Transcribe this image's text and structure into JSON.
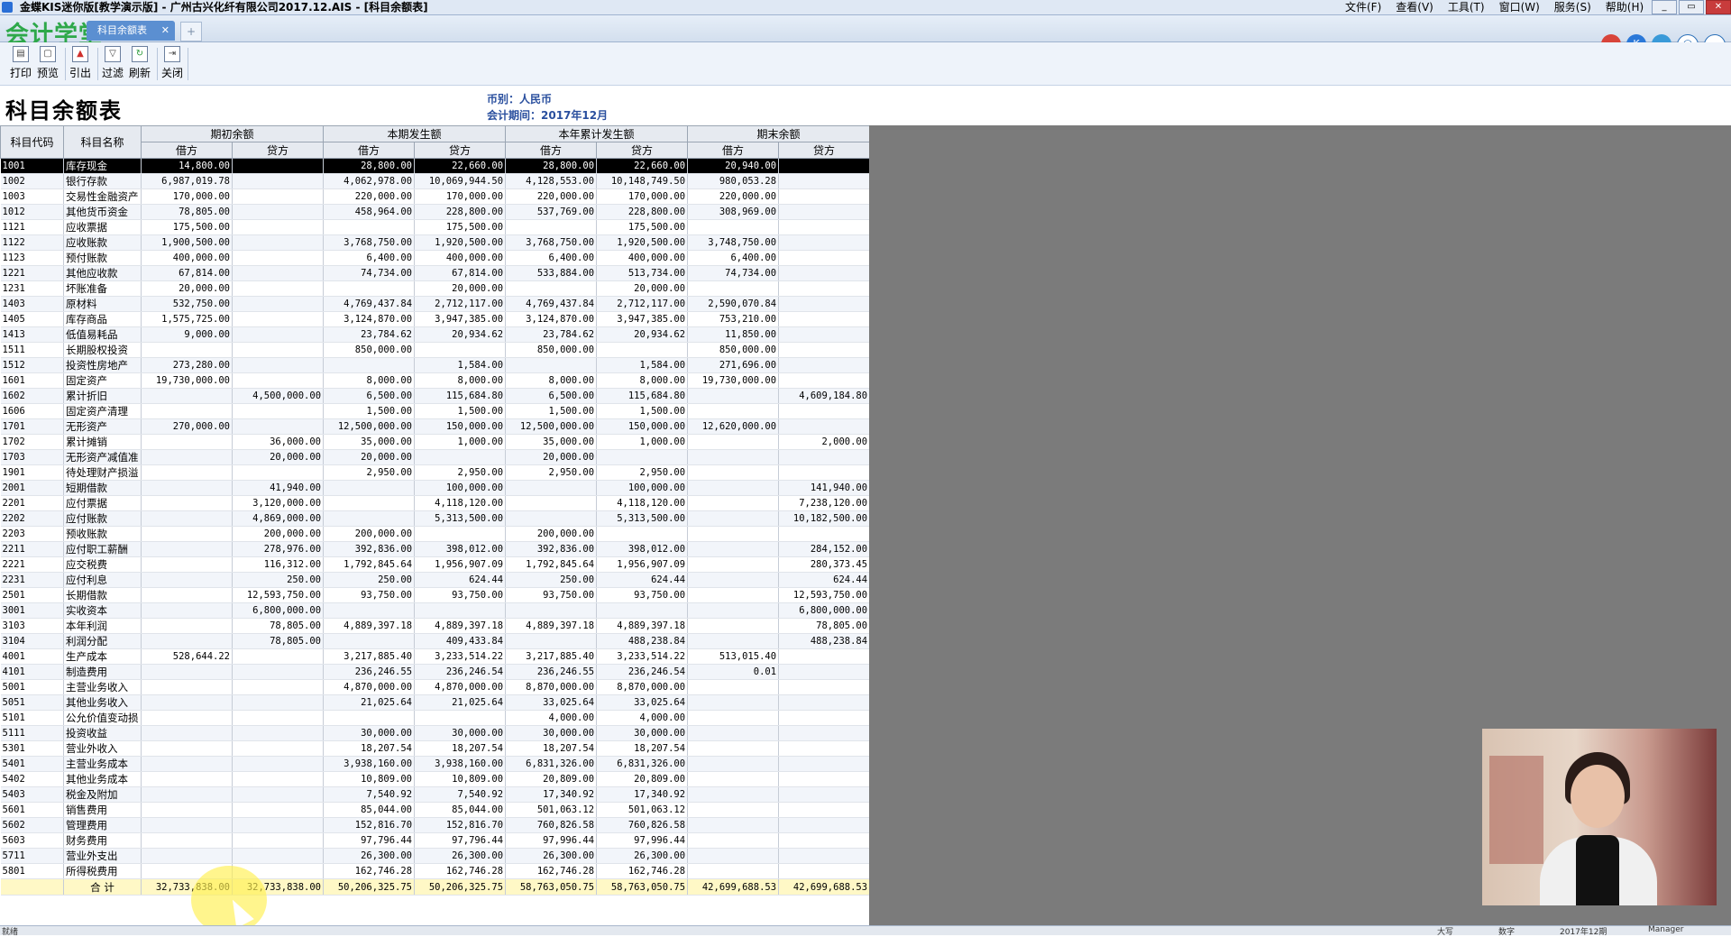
{
  "window": {
    "title": "金蝶KIS迷你版[教学演示版] - 广州古兴化纤有限公司2017.12.AIS - [科目余额表]",
    "menu": [
      "文件(F)",
      "查看(V)",
      "工具(T)",
      "窗口(W)",
      "服务(S)",
      "帮助(H)"
    ],
    "buttons": {
      "minimize": "_",
      "restore": "▭",
      "close": "✕"
    }
  },
  "tabbar": {
    "logo": "会计学堂",
    "tab_label": "科目余额表",
    "tab_close": "✕",
    "new_tab": "+",
    "tray_icons": [
      "cloud-icon",
      "kis-icon",
      "weather-icon",
      "smile-icon",
      "message-icon"
    ]
  },
  "toolbar": {
    "buttons": [
      {
        "label": "打印",
        "icon": "printer-icon"
      },
      {
        "label": "预览",
        "icon": "preview-icon"
      },
      {
        "label": "引出",
        "icon": "export-icon"
      },
      {
        "label": "过滤",
        "icon": "filter-icon"
      },
      {
        "label": "刷新",
        "icon": "refresh-icon"
      },
      {
        "label": "关闭",
        "icon": "close-door-icon"
      }
    ]
  },
  "report": {
    "title": "科目余额表",
    "currency": "币别：人民币",
    "period": "会计期间：2017年12月"
  },
  "table": {
    "code_header": "科目代码",
    "name_header": "科目名称",
    "groups": [
      "期初余额",
      "本期发生额",
      "本年累计发生额",
      "期末余额"
    ],
    "debit": "借方",
    "credit": "贷方",
    "rows": [
      [
        "1001",
        "库存现金",
        "14,800.00",
        "",
        "28,800.00",
        "22,660.00",
        "28,800.00",
        "22,660.00",
        "20,940.00",
        ""
      ],
      [
        "1002",
        "银行存款",
        "6,987,019.78",
        "",
        "4,062,978.00",
        "10,069,944.50",
        "4,128,553.00",
        "10,148,749.50",
        "980,053.28",
        ""
      ],
      [
        "1003",
        "交易性金融资产",
        "170,000.00",
        "",
        "220,000.00",
        "170,000.00",
        "220,000.00",
        "170,000.00",
        "220,000.00",
        ""
      ],
      [
        "1012",
        "其他货币资金",
        "78,805.00",
        "",
        "458,964.00",
        "228,800.00",
        "537,769.00",
        "228,800.00",
        "308,969.00",
        ""
      ],
      [
        "1121",
        "应收票据",
        "175,500.00",
        "",
        "",
        "175,500.00",
        "",
        "175,500.00",
        "",
        ""
      ],
      [
        "1122",
        "应收账款",
        "1,900,500.00",
        "",
        "3,768,750.00",
        "1,920,500.00",
        "3,768,750.00",
        "1,920,500.00",
        "3,748,750.00",
        ""
      ],
      [
        "1123",
        "预付账款",
        "400,000.00",
        "",
        "6,400.00",
        "400,000.00",
        "6,400.00",
        "400,000.00",
        "6,400.00",
        ""
      ],
      [
        "1221",
        "其他应收款",
        "67,814.00",
        "",
        "74,734.00",
        "67,814.00",
        "533,884.00",
        "513,734.00",
        "74,734.00",
        ""
      ],
      [
        "1231",
        "坏账准备",
        "20,000.00",
        "",
        "",
        "20,000.00",
        "",
        "20,000.00",
        "",
        ""
      ],
      [
        "1403",
        "原材料",
        "532,750.00",
        "",
        "4,769,437.84",
        "2,712,117.00",
        "4,769,437.84",
        "2,712,117.00",
        "2,590,070.84",
        ""
      ],
      [
        "1405",
        "库存商品",
        "1,575,725.00",
        "",
        "3,124,870.00",
        "3,947,385.00",
        "3,124,870.00",
        "3,947,385.00",
        "753,210.00",
        ""
      ],
      [
        "1413",
        "低值易耗品",
        "9,000.00",
        "",
        "23,784.62",
        "20,934.62",
        "23,784.62",
        "20,934.62",
        "11,850.00",
        ""
      ],
      [
        "1511",
        "长期股权投资",
        "",
        "",
        "850,000.00",
        "",
        "850,000.00",
        "",
        "850,000.00",
        ""
      ],
      [
        "1512",
        "投资性房地产",
        "273,280.00",
        "",
        "",
        "1,584.00",
        "",
        "1,584.00",
        "271,696.00",
        ""
      ],
      [
        "1601",
        "固定资产",
        "19,730,000.00",
        "",
        "8,000.00",
        "8,000.00",
        "8,000.00",
        "8,000.00",
        "19,730,000.00",
        ""
      ],
      [
        "1602",
        "累计折旧",
        "",
        "4,500,000.00",
        "6,500.00",
        "115,684.80",
        "6,500.00",
        "115,684.80",
        "",
        "4,609,184.80"
      ],
      [
        "1606",
        "固定资产清理",
        "",
        "",
        "1,500.00",
        "1,500.00",
        "1,500.00",
        "1,500.00",
        "",
        ""
      ],
      [
        "1701",
        "无形资产",
        "270,000.00",
        "",
        "12,500,000.00",
        "150,000.00",
        "12,500,000.00",
        "150,000.00",
        "12,620,000.00",
        ""
      ],
      [
        "1702",
        "累计摊销",
        "",
        "36,000.00",
        "35,000.00",
        "1,000.00",
        "35,000.00",
        "1,000.00",
        "",
        "2,000.00"
      ],
      [
        "1703",
        "无形资产减值准",
        "",
        "20,000.00",
        "20,000.00",
        "",
        "20,000.00",
        "",
        "",
        ""
      ],
      [
        "1901",
        "待处理财产损溢",
        "",
        "",
        "2,950.00",
        "2,950.00",
        "2,950.00",
        "2,950.00",
        "",
        ""
      ],
      [
        "2001",
        "短期借款",
        "",
        "41,940.00",
        "",
        "100,000.00",
        "",
        "100,000.00",
        "",
        "141,940.00"
      ],
      [
        "2201",
        "应付票据",
        "",
        "3,120,000.00",
        "",
        "4,118,120.00",
        "",
        "4,118,120.00",
        "",
        "7,238,120.00"
      ],
      [
        "2202",
        "应付账款",
        "",
        "4,869,000.00",
        "",
        "5,313,500.00",
        "",
        "5,313,500.00",
        "",
        "10,182,500.00"
      ],
      [
        "2203",
        "预收账款",
        "",
        "200,000.00",
        "200,000.00",
        "",
        "200,000.00",
        "",
        "",
        ""
      ],
      [
        "2211",
        "应付职工薪酬",
        "",
        "278,976.00",
        "392,836.00",
        "398,012.00",
        "392,836.00",
        "398,012.00",
        "",
        "284,152.00"
      ],
      [
        "2221",
        "应交税费",
        "",
        "116,312.00",
        "1,792,845.64",
        "1,956,907.09",
        "1,792,845.64",
        "1,956,907.09",
        "",
        "280,373.45"
      ],
      [
        "2231",
        "应付利息",
        "",
        "250.00",
        "250.00",
        "624.44",
        "250.00",
        "624.44",
        "",
        "624.44"
      ],
      [
        "2501",
        "长期借款",
        "",
        "12,593,750.00",
        "93,750.00",
        "93,750.00",
        "93,750.00",
        "93,750.00",
        "",
        "12,593,750.00"
      ],
      [
        "3001",
        "实收资本",
        "",
        "6,800,000.00",
        "",
        "",
        "",
        "",
        "",
        "6,800,000.00"
      ],
      [
        "3103",
        "本年利润",
        "",
        "78,805.00",
        "4,889,397.18",
        "4,889,397.18",
        "4,889,397.18",
        "4,889,397.18",
        "",
        "78,805.00"
      ],
      [
        "3104",
        "利润分配",
        "",
        "78,805.00",
        "",
        "409,433.84",
        "",
        "488,238.84",
        "",
        "488,238.84"
      ],
      [
        "4001",
        "生产成本",
        "528,644.22",
        "",
        "3,217,885.40",
        "3,233,514.22",
        "3,217,885.40",
        "3,233,514.22",
        "513,015.40",
        ""
      ],
      [
        "4101",
        "制造费用",
        "",
        "",
        "236,246.55",
        "236,246.54",
        "236,246.55",
        "236,246.54",
        "0.01",
        ""
      ],
      [
        "5001",
        "主营业务收入",
        "",
        "",
        "4,870,000.00",
        "4,870,000.00",
        "8,870,000.00",
        "8,870,000.00",
        "",
        ""
      ],
      [
        "5051",
        "其他业务收入",
        "",
        "",
        "21,025.64",
        "21,025.64",
        "33,025.64",
        "33,025.64",
        "",
        ""
      ],
      [
        "5101",
        "公允价值变动损",
        "",
        "",
        "",
        "",
        "4,000.00",
        "4,000.00",
        "",
        ""
      ],
      [
        "5111",
        "投资收益",
        "",
        "",
        "30,000.00",
        "30,000.00",
        "30,000.00",
        "30,000.00",
        "",
        ""
      ],
      [
        "5301",
        "营业外收入",
        "",
        "",
        "18,207.54",
        "18,207.54",
        "18,207.54",
        "18,207.54",
        "",
        ""
      ],
      [
        "5401",
        "主营业务成本",
        "",
        "",
        "3,938,160.00",
        "3,938,160.00",
        "6,831,326.00",
        "6,831,326.00",
        "",
        ""
      ],
      [
        "5402",
        "其他业务成本",
        "",
        "",
        "10,809.00",
        "10,809.00",
        "20,809.00",
        "20,809.00",
        "",
        ""
      ],
      [
        "5403",
        "税金及附加",
        "",
        "",
        "7,540.92",
        "7,540.92",
        "17,340.92",
        "17,340.92",
        "",
        ""
      ],
      [
        "5601",
        "销售费用",
        "",
        "",
        "85,044.00",
        "85,044.00",
        "501,063.12",
        "501,063.12",
        "",
        ""
      ],
      [
        "5602",
        "管理费用",
        "",
        "",
        "152,816.70",
        "152,816.70",
        "760,826.58",
        "760,826.58",
        "",
        ""
      ],
      [
        "5603",
        "财务费用",
        "",
        "",
        "97,796.44",
        "97,796.44",
        "97,996.44",
        "97,996.44",
        "",
        ""
      ],
      [
        "5711",
        "营业外支出",
        "",
        "",
        "26,300.00",
        "26,300.00",
        "26,300.00",
        "26,300.00",
        "",
        ""
      ],
      [
        "5801",
        "所得税费用",
        "",
        "",
        "162,746.28",
        "162,746.28",
        "162,746.28",
        "162,746.28",
        "",
        ""
      ]
    ],
    "total": [
      "",
      "合  计",
      "32,733,838.00",
      "32,733,838.00",
      "50,206,325.75",
      "50,206,325.75",
      "58,763,050.75",
      "58,763,050.75",
      "42,699,688.53",
      "42,699,688.53"
    ]
  },
  "status": {
    "left": "就绪",
    "caps": "大写",
    "num": "数字",
    "period": "2017年12期",
    "user": "Manager"
  },
  "colors": {
    "selected_row": "#000000",
    "total_row": "#fff8c6",
    "meta_text": "#2a4f9e",
    "workspace_grey": "#7b7b7b"
  }
}
